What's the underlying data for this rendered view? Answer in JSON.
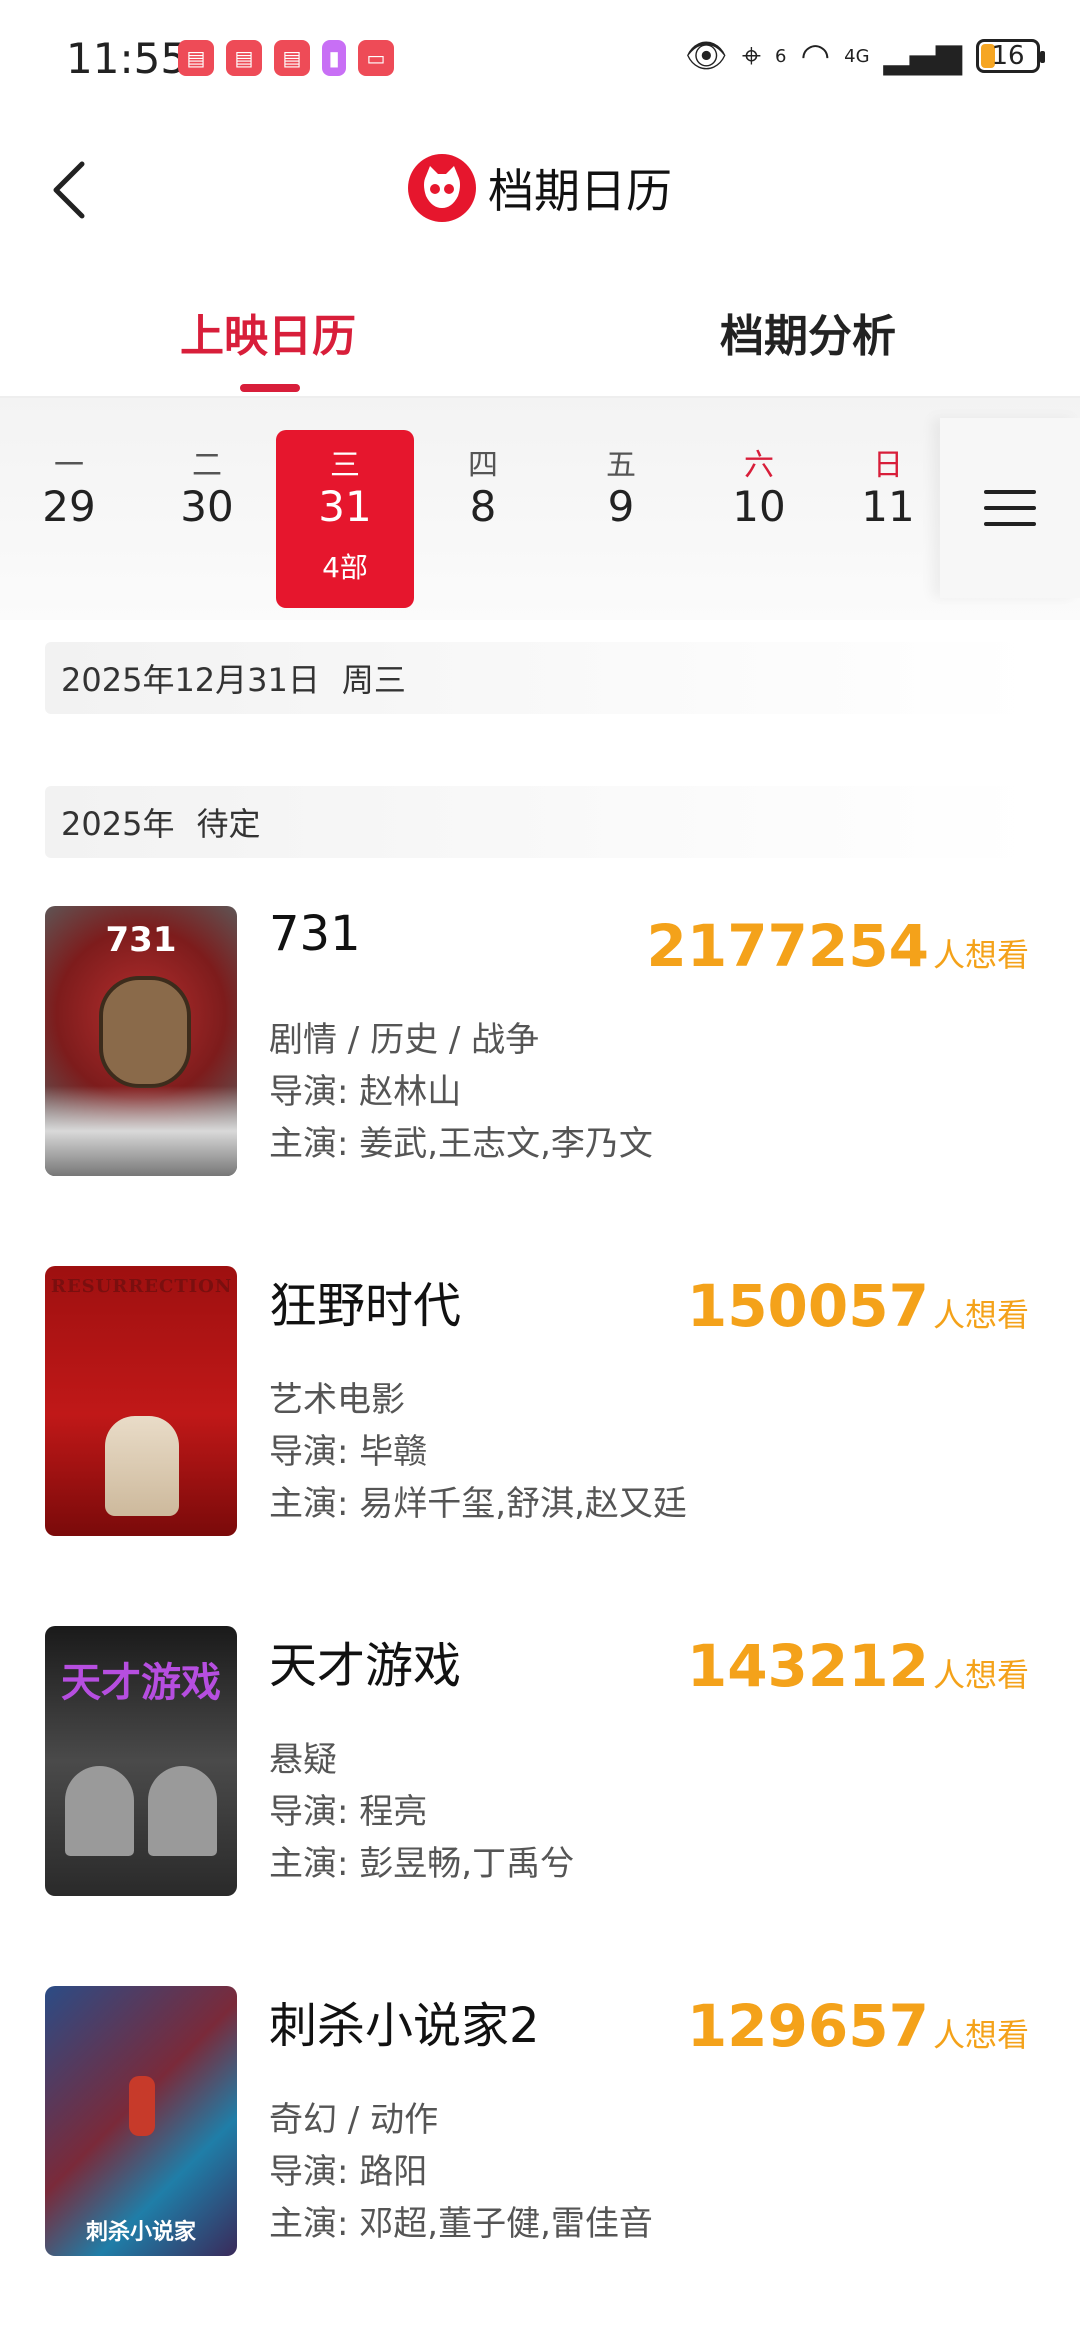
{
  "status_bar": {
    "time": "11:55",
    "apps": [
      "book-app",
      "book-app",
      "book-app",
      "gallery-app",
      "huawei-app"
    ],
    "signal_label": "4G",
    "wifi_label": "6",
    "battery": "16"
  },
  "header": {
    "title": "档期日历"
  },
  "tabs": {
    "calendar": "上映日历",
    "analysis": "档期分析",
    "active": "calendar"
  },
  "week": {
    "days": [
      {
        "weekday": "一",
        "date": "29",
        "count": ""
      },
      {
        "weekday": "二",
        "date": "30",
        "count": ""
      },
      {
        "weekday": "三",
        "date": "31",
        "count": "4部"
      },
      {
        "weekday": "四",
        "date": "8",
        "count": ""
      },
      {
        "weekday": "五",
        "date": "9",
        "count": ""
      },
      {
        "weekday": "六",
        "date": "10",
        "count": ""
      },
      {
        "weekday": "日",
        "date": "11",
        "count": ""
      }
    ],
    "selected_index": 2
  },
  "date_header": {
    "date": "2025年12月31日",
    "weekday": "周三"
  },
  "section_header": {
    "year": "2025年",
    "status": "待定"
  },
  "movies": [
    {
      "title": "731",
      "want_count": "2177254",
      "want_label": "人想看",
      "genre": "剧情 / 历史 / 战争",
      "director": "导演: 赵林山",
      "cast": "主演: 姜武,王志文,李乃文",
      "poster_text": "731"
    },
    {
      "title": "狂野时代",
      "want_count": "150057",
      "want_label": "人想看",
      "genre": "艺术电影",
      "director": "导演: 毕赣",
      "cast": "主演: 易烊千玺,舒淇,赵又廷",
      "poster_text": "RESURRECTION"
    },
    {
      "title": "天才游戏",
      "want_count": "143212",
      "want_label": "人想看",
      "genre": "悬疑",
      "director": "导演: 程亮",
      "cast": "主演: 彭昱畅,丁禹兮",
      "poster_text": "天才游戏"
    },
    {
      "title": "刺杀小说家2",
      "want_count": "129657",
      "want_label": "人想看",
      "genre": "奇幻 / 动作",
      "director": "导演: 路阳",
      "cast": "主演: 邓超,董子健,雷佳音",
      "poster_text": "刺杀小说家"
    }
  ],
  "colors": {
    "accent": "#e6162d",
    "want": "#f4a21a"
  }
}
